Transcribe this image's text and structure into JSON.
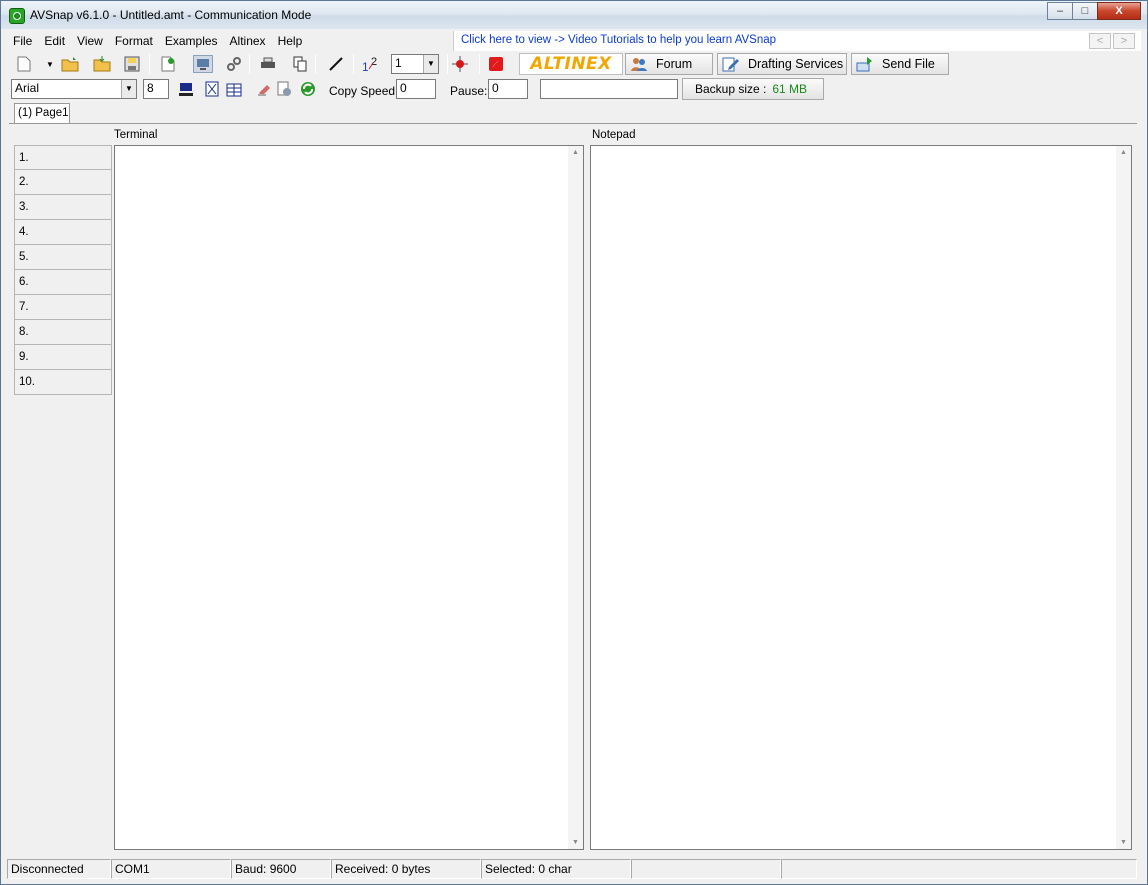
{
  "window": {
    "title": "AVSnap v6.1.0 - Untitled.amt  - Communication Mode",
    "controls": {
      "minimize": "–",
      "maximize": "□",
      "close": "X"
    }
  },
  "menu": {
    "items": [
      "File",
      "Edit",
      "View",
      "Format",
      "Examples",
      "Altinex",
      "Help"
    ]
  },
  "banner": {
    "link_text": "Click here to view -> Video Tutorials to help you learn AVSnap",
    "prev": "<",
    "next": ">"
  },
  "toolbar1": {
    "page_select_value": "1",
    "altinex_logo": "ALTINEX",
    "forum_label": "Forum",
    "drafting_label": "Drafting Services",
    "send_file_label": "Send File"
  },
  "toolbar2": {
    "font_value": "Arial",
    "font_size_value": "8",
    "copy_speed_label": "Copy Speed:",
    "copy_speed_value": "0",
    "pause_label": "Pause:",
    "pause_value": "0",
    "blank_field_value": "",
    "backup_label": "Backup size :",
    "backup_value": "61 MB"
  },
  "tabs": [
    {
      "label": "(1) Page1"
    }
  ],
  "terminal": {
    "label": "Terminal",
    "row_numbers": [
      "1.",
      "2.",
      "3.",
      "4.",
      "5.",
      "6.",
      "7.",
      "8.",
      "9.",
      "10."
    ]
  },
  "notepad": {
    "label": "Notepad"
  },
  "status": {
    "connection": "Disconnected",
    "port": "COM1",
    "baud": "Baud: 9600",
    "received": "Received: 0 bytes",
    "selected": "Selected: 0 char"
  },
  "colors": {
    "link": "#0a3ccf",
    "backup_value": "#1b8a1b",
    "altinex_logo": "#f0a800"
  }
}
